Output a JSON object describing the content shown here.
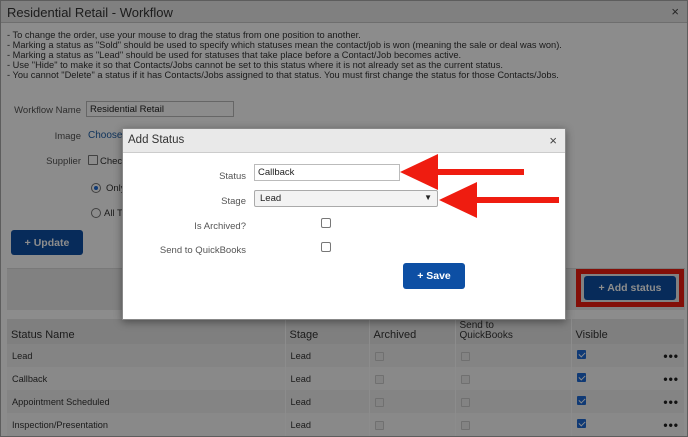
{
  "window": {
    "title": "Residential Retail - Workflow",
    "close": "×"
  },
  "instructions": [
    "- To change the order, use your mouse to drag the status from one position to another.",
    "- Marking a status as \"Sold\" should be used to specify which statuses mean the contact/job is won (meaning the sale or deal was won).",
    "- Marking a status as \"Lead\" should be used for statuses that take place before a Contact/Job becomes active.",
    "- Use \"Hide\" to make it so that Contacts/Jobs cannot be set to this status where it is not already set as the current status.",
    "- You cannot \"Delete\" a status if it has Contacts/Jobs assigned to that status. You must first change the status for those Contacts/Jobs."
  ],
  "form": {
    "workflow_name_label": "Workflow Name",
    "workflow_name_value": "Residential Retail",
    "image_label": "Image",
    "choose_link": "Choose",
    "supplier_label": "Supplier",
    "supplier_check_label": "Check",
    "only_label": "Only",
    "all_label": "All To",
    "update_button": "+ Update"
  },
  "toolbar": {
    "add_status_button": "+ Add status"
  },
  "table": {
    "headers": {
      "status_name": "Status Name",
      "stage": "Stage",
      "archived": "Archived",
      "send_line1": "Send to",
      "send_line2": "QuickBooks",
      "visible": "Visible"
    },
    "rows": [
      {
        "name": "Lead",
        "stage": "Lead",
        "archived": false,
        "send": false,
        "visible": true,
        "menu": "•••"
      },
      {
        "name": "Callback",
        "stage": "Lead",
        "archived": false,
        "send": false,
        "visible": true,
        "menu": "•••"
      },
      {
        "name": "Appointment Scheduled",
        "stage": "Lead",
        "archived": false,
        "send": false,
        "visible": true,
        "menu": "•••"
      },
      {
        "name": "Inspection/Presentation",
        "stage": "Lead",
        "archived": false,
        "send": false,
        "visible": true,
        "menu": "•••"
      }
    ]
  },
  "dialog": {
    "title": "Add Status",
    "close": "×",
    "status_label": "Status",
    "status_value": "Callback",
    "stage_label": "Stage",
    "stage_value": "Lead",
    "archived_label": "Is Archived?",
    "archived_checked": false,
    "quickbooks_label": "Send to QuickBooks",
    "quickbooks_checked": false,
    "save_button": "+ Save"
  },
  "colors": {
    "primary_button": "#0d4fa4",
    "annotation_red": "#ef1c10",
    "checkbox_blue": "#1e6bd6"
  }
}
